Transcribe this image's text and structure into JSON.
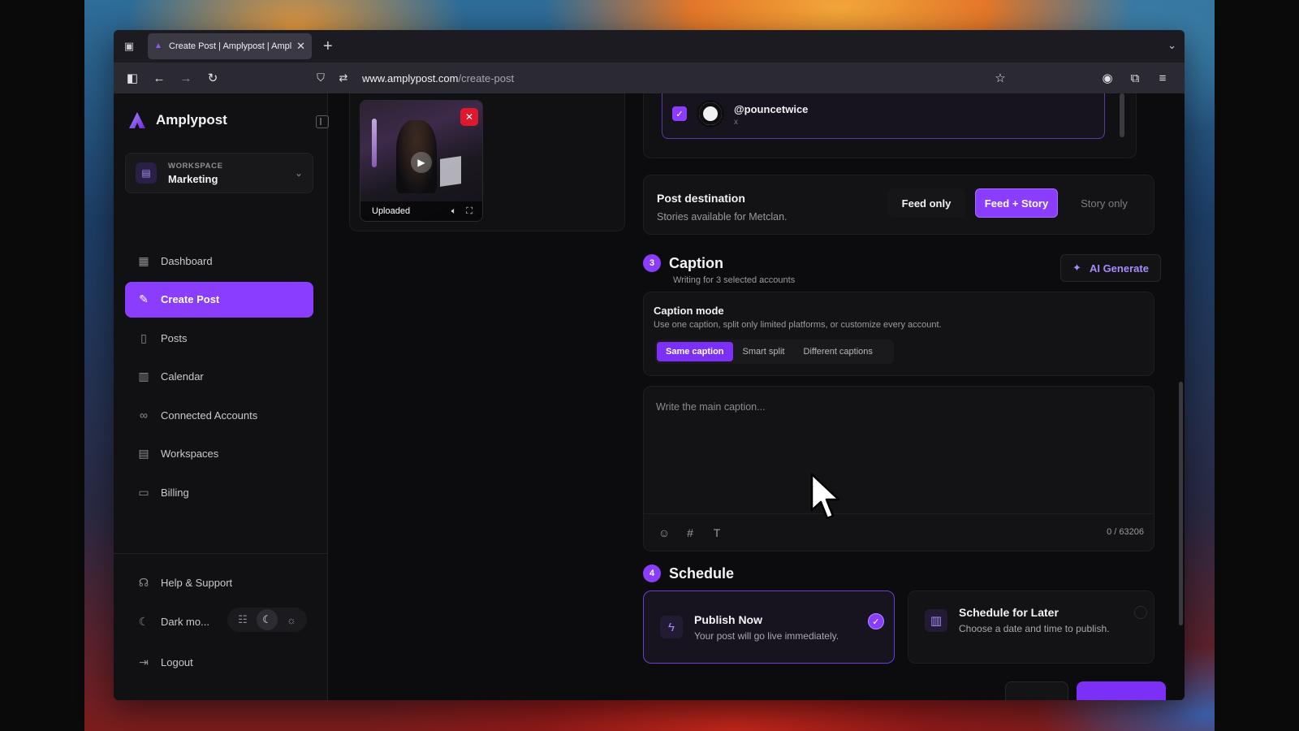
{
  "browser": {
    "tab_title": "Create Post | Amplypost | Amply",
    "url_host": "www.amplypost.com",
    "url_path": "/create-post"
  },
  "sidebar": {
    "brand": "Amplypost",
    "workspace_label": "WORKSPACE",
    "workspace_name": "Marketing",
    "items": [
      {
        "label": "Dashboard",
        "icon": "grid-icon"
      },
      {
        "label": "Create Post",
        "icon": "pen-icon",
        "active": true
      },
      {
        "label": "Posts",
        "icon": "clipboard-icon"
      },
      {
        "label": "Calendar",
        "icon": "calendar-icon"
      },
      {
        "label": "Connected Accounts",
        "icon": "link-icon"
      },
      {
        "label": "Workspaces",
        "icon": "briefcase-icon"
      },
      {
        "label": "Billing",
        "icon": "credit-card-icon"
      }
    ],
    "help": "Help & Support",
    "dark_mode": "Dark mo...",
    "logout": "Logout"
  },
  "media": {
    "status": "Uploaded"
  },
  "account": {
    "handle": "@pouncetwice",
    "platform": "x"
  },
  "destination": {
    "title": "Post destination",
    "subtitle": "Stories available for Metclan.",
    "options": [
      "Feed only",
      "Feed + Story",
      "Story only"
    ],
    "selected": "Feed + Story"
  },
  "caption": {
    "step": "3",
    "title": "Caption",
    "subtitle": "Writing for 3 selected accounts",
    "ai_button": "AI Generate",
    "mode_title": "Caption mode",
    "mode_desc": "Use one caption, split only limited platforms, or customize every account.",
    "modes": [
      "Same caption",
      "Smart split",
      "Different captions"
    ],
    "selected_mode": "Same caption",
    "placeholder": "Write the main caption...",
    "value": "",
    "counter": "0 / 63206"
  },
  "schedule": {
    "step": "4",
    "title": "Schedule",
    "now_title": "Publish Now",
    "now_desc": "Your post will go live immediately.",
    "later_title": "Schedule for Later",
    "later_desc": "Choose a date and time to publish.",
    "selected": "Publish Now"
  },
  "colors": {
    "accent": "#8b3dff",
    "background": "#0c0c0e",
    "surface": "#131315"
  }
}
